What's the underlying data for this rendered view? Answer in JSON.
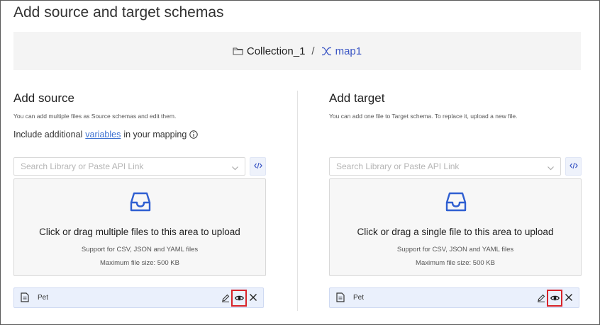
{
  "page": {
    "title": "Add source and target schemas"
  },
  "breadcrumb": {
    "collection": "Collection_1",
    "separator": "/",
    "map": "map1"
  },
  "source": {
    "title": "Add source",
    "description": "You can add multiple files as Source schemas and edit them.",
    "include_prefix": "Include additional",
    "include_link": "variables",
    "include_suffix": "in your mapping",
    "search_placeholder": "Search Library or Paste API Link",
    "dropzone_main": "Click or drag multiple files to this area to upload",
    "dropzone_support": "Support for CSV, JSON and YAML files",
    "dropzone_max": "Maximum file size: 500 KB",
    "file_name": "Pet"
  },
  "target": {
    "title": "Add target",
    "description": "You can add one file to Target schema. To replace it, upload a new file.",
    "search_placeholder": "Search Library or Paste API Link",
    "dropzone_main": "Click or drag a single file to this area to upload",
    "dropzone_support": "Support for CSV, JSON and YAML files",
    "dropzone_max": "Maximum file size: 500 KB",
    "file_name": "Pet"
  },
  "colors": {
    "accent": "#3a55c4",
    "link": "#3a6fd0",
    "highlight_box": "#d8232a",
    "file_row_bg": "#eaf0fc"
  },
  "icons": [
    "folder-icon",
    "map-icon",
    "info-icon",
    "chevron-down-icon",
    "code-icon",
    "inbox-tray-icon",
    "document-icon",
    "edit-icon",
    "eye-icon",
    "close-icon"
  ]
}
